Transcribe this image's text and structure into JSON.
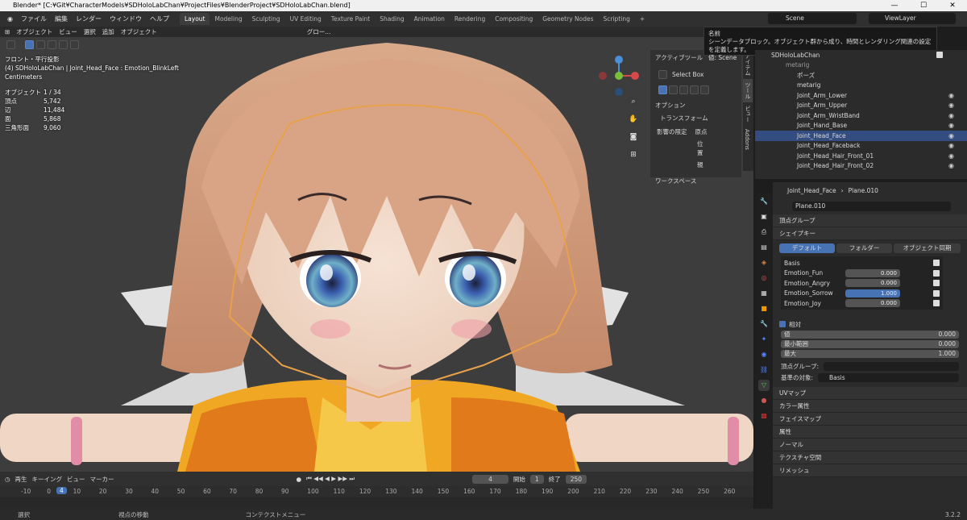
{
  "titlebar": {
    "title": "Blender* [C:¥Git¥CharacterModels¥SDHoloLabChan¥ProjectFiles¥BlenderProject¥SDHoloLabChan.blend]",
    "minimize": "—",
    "maximize": "☐",
    "close": "✕"
  },
  "menu": {
    "items": [
      "ファイル",
      "編集",
      "レンダー",
      "ウィンドウ",
      "ヘルプ"
    ],
    "workspaces": [
      "Layout",
      "Modeling",
      "Sculpting",
      "UV Editing",
      "Texture Paint",
      "Shading",
      "Animation",
      "Rendering",
      "Compositing",
      "Geometry Nodes",
      "Scripting"
    ],
    "add": "+",
    "scene": "Scene",
    "viewlayer": "ViewLayer"
  },
  "viewport": {
    "header": {
      "mode": "オブジェクト",
      "view": "ビュー",
      "select": "選択",
      "add": "追加",
      "object": "オブジェクト",
      "orientation": "グロー..."
    },
    "overlay": {
      "line1": "フロント・平行投影",
      "line2": "(4) SDHoloLabChan | Joint_Head_Face : Emotion_BlinkLeft",
      "line3": "Centimeters"
    },
    "stats": [
      {
        "k": "オブジェクト",
        "v": "1 / 34"
      },
      {
        "k": "頂点",
        "v": "5,742"
      },
      {
        "k": "辺",
        "v": "11,484"
      },
      {
        "k": "面",
        "v": "5,868"
      },
      {
        "k": "三角形面",
        "v": "9,060"
      }
    ],
    "npanel": {
      "active_tool": "アクティブツール",
      "select_box": "Select Box",
      "options": "オプション",
      "transform": "トランスフォーム",
      "affect": "影響の限定",
      "origin": "原点",
      "location": "位置",
      "parent": "親",
      "workspace": "ワークスペース"
    },
    "ntabs": [
      "アイテム",
      "ツール",
      "ビュー",
      "Addons"
    ]
  },
  "tooltip": {
    "title": "名前",
    "desc": "シーンデータブロック。オブジェクト群から成り、時間とレンダリング関連の設定を定義します。",
    "value": "値: Scene"
  },
  "outliner": {
    "rows": [
      {
        "name": "SDHoloLabChan",
        "indent": 0,
        "sel": false
      },
      {
        "name": "metarig",
        "indent": 1,
        "sel": false
      },
      {
        "name": "ポーズ",
        "indent": 2,
        "sel": false
      },
      {
        "name": "metarig",
        "indent": 2,
        "sel": false
      },
      {
        "name": "Joint_Arm_Lower",
        "indent": 2,
        "sel": false
      },
      {
        "name": "Joint_Arm_Upper",
        "indent": 2,
        "sel": false
      },
      {
        "name": "Joint_Arm_WristBand",
        "indent": 2,
        "sel": false
      },
      {
        "name": "Joint_Hand_Base",
        "indent": 2,
        "sel": false
      },
      {
        "name": "Joint_Head_Face",
        "indent": 2,
        "sel": true
      },
      {
        "name": "Joint_Head_Faceback",
        "indent": 2,
        "sel": false
      },
      {
        "name": "Joint_Head_Hair_Front_01",
        "indent": 2,
        "sel": false
      },
      {
        "name": "Joint_Head_Hair_Front_02",
        "indent": 2,
        "sel": false
      }
    ]
  },
  "props": {
    "breadcrumb_obj": "Joint_Head_Face",
    "breadcrumb_mesh": "Plane.010",
    "mesh_name": "Plane.010",
    "vertex_groups": "頂点グループ",
    "shape_keys": "シェイプキー",
    "tabs": [
      "デフォルト",
      "フォルダー",
      "オブジェクト同期"
    ],
    "keys": [
      {
        "name": "Basis",
        "value": ""
      },
      {
        "name": "Emotion_Fun",
        "value": "0.000"
      },
      {
        "name": "Emotion_Angry",
        "value": "0.000"
      },
      {
        "name": "Emotion_Sorrow",
        "value": "1.000",
        "sel": true
      },
      {
        "name": "Emotion_Joy",
        "value": "0.000"
      }
    ],
    "relative": "相対",
    "value_label": "値",
    "value": "0.000",
    "min_label": "最小範囲",
    "min": "0.000",
    "max_label": "最大",
    "max": "1.000",
    "vgroup_label": "頂点グループ:",
    "ref_label": "基準の対象:",
    "ref_value": "Basis",
    "sections": [
      "UVマップ",
      "カラー属性",
      "フェイスマップ",
      "属性",
      "ノーマル",
      "テクスチャ空間",
      "リメッシュ"
    ]
  },
  "timeline": {
    "playback": "再生",
    "keying": "キーイング",
    "view": "ビュー",
    "marker": "マーカー",
    "current": "4",
    "start_label": "開始",
    "start": "1",
    "end_label": "終了",
    "end": "250",
    "ticks": [
      "-10",
      "0",
      "10",
      "20",
      "30",
      "40",
      "50",
      "60",
      "70",
      "80",
      "90",
      "100",
      "110",
      "120",
      "130",
      "140",
      "150",
      "160",
      "170",
      "180",
      "190",
      "200",
      "210",
      "220",
      "230",
      "240",
      "250",
      "260"
    ]
  },
  "status": {
    "select": "選択",
    "move": "視点の移動",
    "context": "コンテクストメニュー",
    "version": "3.2.2"
  },
  "colors": {
    "accent": "#4772b3",
    "selection": "#334d80",
    "orange": "#e8a14a"
  }
}
